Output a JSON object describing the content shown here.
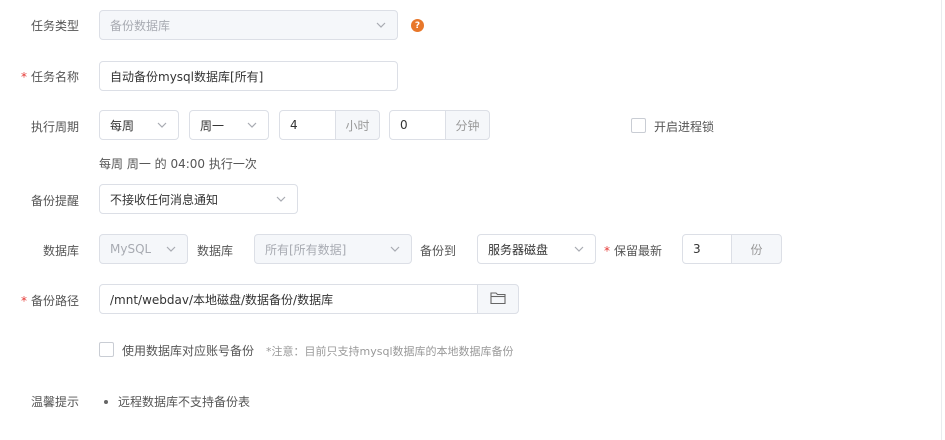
{
  "task_type": {
    "label": "任务类型",
    "value": "备份数据库"
  },
  "task_name": {
    "label": "任务名称",
    "value": "自动备份mysql数据库[所有]"
  },
  "cycle": {
    "label": "执行周期",
    "frequency": "每周",
    "weekday": "周一",
    "hour": "4",
    "hour_unit": "小时",
    "minute": "0",
    "minute_unit": "分钟",
    "process_lock_label": "开启进程锁",
    "summary": "每周 周一 的 04:00 执行一次"
  },
  "reminder": {
    "label": "备份提醒",
    "value": "不接收任何消息通知"
  },
  "database": {
    "label": "数据库",
    "type": "MySQL",
    "db_label": "数据库",
    "db_value": "所有[所有数据]",
    "backup_to_label": "备份到",
    "backup_to_value": "服务器磁盘",
    "keep_label": "保留最新",
    "keep_value": "3",
    "keep_unit": "份"
  },
  "backup_path": {
    "label": "备份路径",
    "value": "/mnt/webdav/本地磁盘/数据备份/数据库"
  },
  "account_backup": {
    "label": "使用数据库对应账号备份",
    "note": "*注意：目前只支持mysql数据库的本地数据库备份"
  },
  "tips": {
    "label": "温馨提示",
    "items": [
      "远程数据库不支持备份表"
    ]
  },
  "colors": {
    "help": "#e8772a",
    "required": "#e53935",
    "disabled_bg": "#f5f7fa",
    "border": "#dcdfe6"
  },
  "icons": {
    "help": "question-circle-icon",
    "folder": "folder-icon",
    "select": "chevron-down-icon"
  }
}
